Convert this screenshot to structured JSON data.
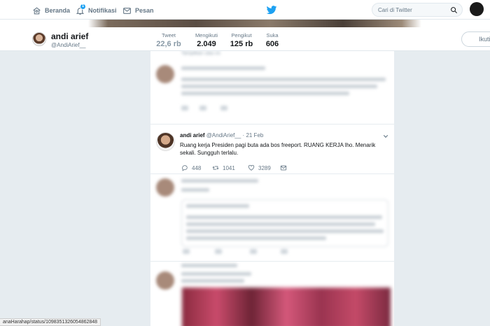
{
  "nav": {
    "home_label": "Beranda",
    "notifications_label": "Notifikasi",
    "notifications_badge": "1",
    "messages_label": "Pesan",
    "search_placeholder": "Cari di Twitter"
  },
  "profile": {
    "name": "andi arief",
    "handle": "@AndiArief__",
    "stats": [
      {
        "label": "Tweet",
        "value": "22,6 rb"
      },
      {
        "label": "Mengikuti",
        "value": "2.049"
      },
      {
        "label": "Pengikut",
        "value": "125 rb"
      },
      {
        "label": "Suka",
        "value": "606"
      }
    ],
    "follow_label": "Ikuti"
  },
  "timeline": {
    "show_above_label": "Tampilkan utas ini"
  },
  "tweet": {
    "name": "andi arief",
    "handle": "@AndiArief__",
    "date": "21 Feb",
    "text": "Ruang kerja Presiden pagi buta ada bos freeport. RUANG KERJA lho. Menarik sekali. Sungguh terlalu.",
    "replies": "448",
    "retweets": "1041",
    "likes": "3289"
  },
  "status_url": "anaHarahap/status/1098351326054862848",
  "colors": {
    "brand": "#1da1f2",
    "background": "#e6ecf0"
  }
}
